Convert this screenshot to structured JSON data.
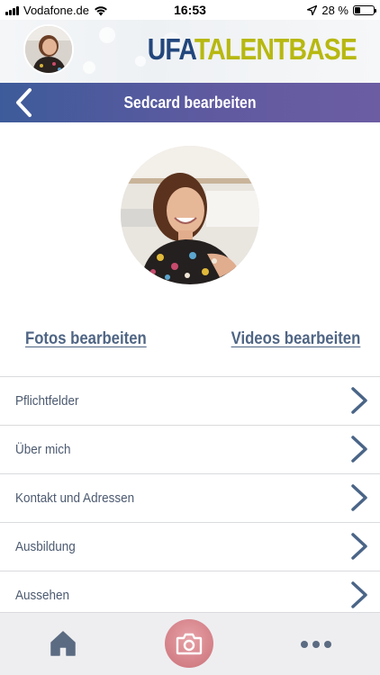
{
  "status_bar": {
    "carrier": "Vodafone.de",
    "time": "16:53",
    "battery": "28 %",
    "battery_level": 0.28,
    "icons": [
      "signal-icon",
      "wifi-icon",
      "location-arrow-icon",
      "battery-icon"
    ]
  },
  "header": {
    "logo_part1": "UFA",
    "logo_part2": "TALENTBASE",
    "logo_color_1": "#22467c",
    "logo_color_2": "#b7b80f"
  },
  "title_bar": {
    "title": "Sedcard bearbeiten",
    "back_icon": "chevron-left-icon",
    "gradient": [
      "#3d5b9a",
      "#6c5da3"
    ]
  },
  "profile": {
    "photo_icon": "profile-photo"
  },
  "links": {
    "photos": "Fotos bearbeiten",
    "videos": "Videos bearbeiten",
    "color": "#4f6584"
  },
  "menu": {
    "items": [
      {
        "label": "Pflichtfelder"
      },
      {
        "label": "Über mich"
      },
      {
        "label": "Kontakt und Adressen"
      },
      {
        "label": "Ausbildung"
      },
      {
        "label": "Aussehen"
      }
    ],
    "chevron_icon": "chevron-right-icon",
    "chevron_color": "#4a6587"
  },
  "tab_bar": {
    "home_icon": "home-icon",
    "camera_icon": "camera-icon",
    "more_icon": "more-dots-icon",
    "camera_color": "#d6848b"
  }
}
